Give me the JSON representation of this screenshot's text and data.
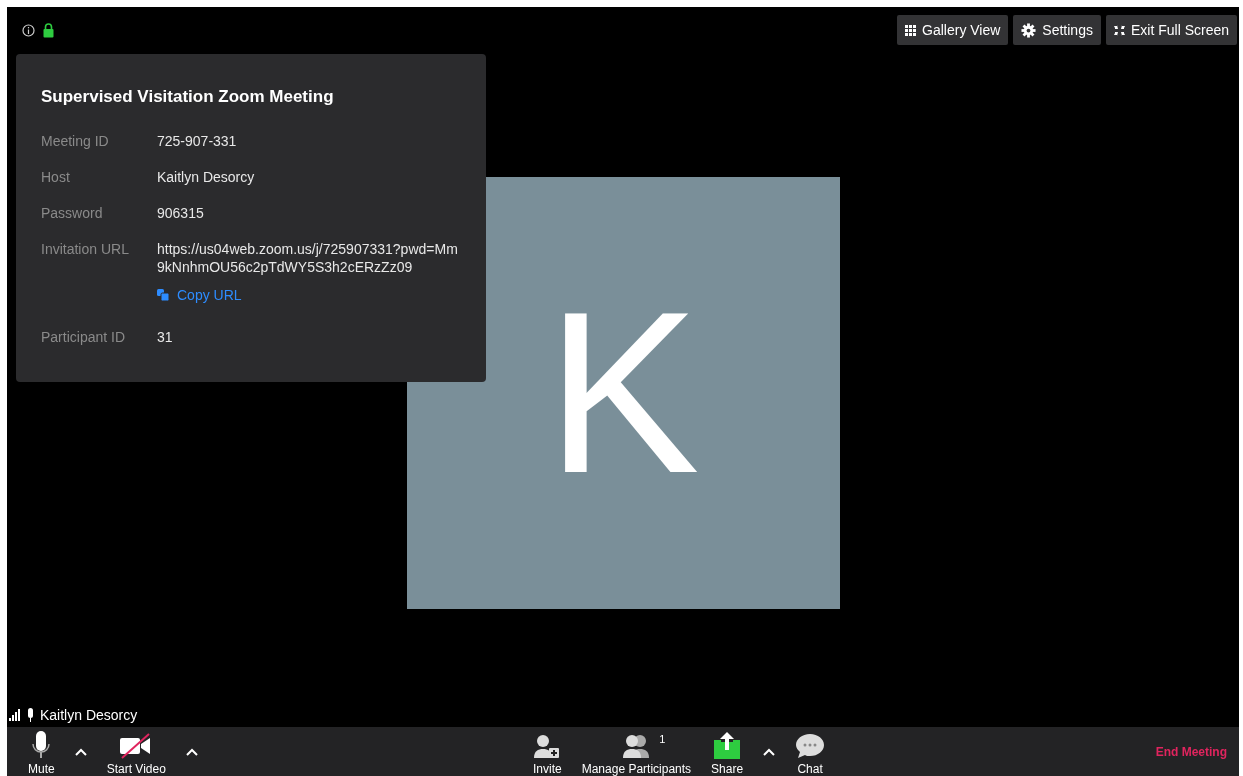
{
  "top_buttons": [
    {
      "kind": "gallery",
      "label": "Gallery View"
    },
    {
      "kind": "settings",
      "label": "Settings"
    },
    {
      "kind": "exit",
      "label": "Exit Full Screen"
    }
  ],
  "info_panel": {
    "title": "Supervised Visitation Zoom Meeting",
    "rows": [
      {
        "label": "Meeting ID",
        "value": "725-907-331"
      },
      {
        "label": "Host",
        "value": "Kaitlyn Desorcy"
      },
      {
        "label": "Password",
        "value": "906315"
      },
      {
        "label": "Invitation URL",
        "value": "https://us04web.zoom.us/j/725907331?pwd=Mm9kNnhmOU56c2pTdWY5S3h2cERzZz09",
        "link": "Copy URL"
      },
      {
        "label": "Participant ID",
        "value": "31"
      }
    ]
  },
  "video_tile": {
    "initial": "K"
  },
  "participant_name": "Kaitlyn Desorcy",
  "toolbar": {
    "left": [
      {
        "kind": "mic",
        "label": "Mute"
      },
      {
        "kind": "caret"
      },
      {
        "kind": "video",
        "label": "Start Video",
        "video_on": false
      },
      {
        "kind": "caret"
      }
    ],
    "center": [
      {
        "kind": "invite",
        "label": "Invite"
      },
      {
        "kind": "participants",
        "label": "Manage Participants",
        "count": "1"
      },
      {
        "kind": "share",
        "label": "Share"
      },
      {
        "kind": "caret"
      },
      {
        "kind": "chat",
        "label": "Chat"
      }
    ],
    "end_button": "End Meeting"
  }
}
